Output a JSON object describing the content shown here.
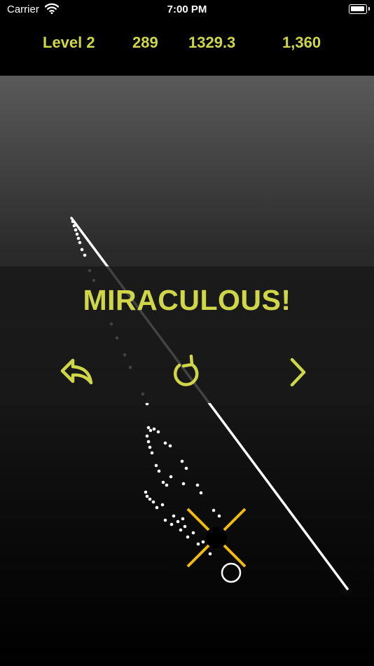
{
  "status_bar": {
    "carrier": "Carrier",
    "time": "7:00 PM",
    "wifi_icon": "wifi-icon",
    "battery_icon": "battery-icon"
  },
  "hud": {
    "level": "Level 2",
    "shots": "289",
    "distance": "1329.3",
    "score": "1,360"
  },
  "banner": {
    "title": "MIRACULOUS!"
  },
  "controls": {
    "undo_icon": "undo-arrow-icon",
    "restart_icon": "restart-icon",
    "next_icon": "chevron-right-icon"
  },
  "colors": {
    "accent": "#cfd648",
    "target": "#f2b90f",
    "dots": "#ffffff",
    "background_top": "#5a5a5a",
    "background_bottom": "#000000"
  }
}
